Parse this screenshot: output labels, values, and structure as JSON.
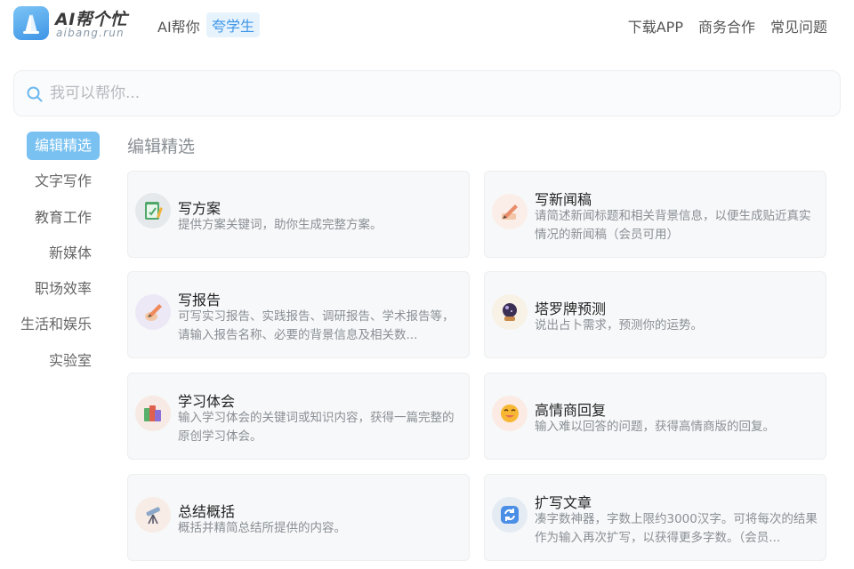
{
  "header": {
    "brand_title": "AI帮个忙",
    "brand_sub": "aibang.run",
    "slogan": "AI帮你",
    "slogan_tag": "夸学生",
    "nav": [
      "下载APP",
      "商务合作",
      "常见问题"
    ]
  },
  "search": {
    "placeholder": "我可以帮你..."
  },
  "sidebar": {
    "items": [
      "编辑精选",
      "文字写作",
      "教育工作",
      "新媒体",
      "职场效率",
      "生活和娱乐",
      "实验室"
    ],
    "active_index": 0
  },
  "main": {
    "section_title": "编辑精选",
    "cards": [
      {
        "title": "写方案",
        "desc": "提供方案关键词，助你生成完整方案。",
        "icon": "clipboard-pen-icon"
      },
      {
        "title": "写新闻稿",
        "desc": "请简述新闻标题和相关背景信息，以便生成贴近真实情况的新闻稿（会员可用）",
        "icon": "pen-writing-icon"
      },
      {
        "title": "写报告",
        "desc": "可写实习报告、实践报告、调研报告、学术报告等，请输入报告名称、必要的背景信息及相关数...",
        "icon": "pencil-hand-icon"
      },
      {
        "title": "塔罗牌预测",
        "desc": "说出占卜需求，预测你的运势。",
        "icon": "crystal-ball-icon"
      },
      {
        "title": "学习体会",
        "desc": "输入学习体会的关键词或知识内容，获得一篇完整的原创学习体会。",
        "icon": "books-icon"
      },
      {
        "title": "高情商回复",
        "desc": "输入难以回答的问题，获得高情商版的回复。",
        "icon": "smile-emoji-icon"
      },
      {
        "title": "总结概括",
        "desc": "概括并精简总结所提供的内容。",
        "icon": "telescope-icon"
      },
      {
        "title": "扩写文章",
        "desc": "凑字数神器，字数上限约3000汉字。可将每次的结果作为输入再次扩写，以获得更多字数。（会员...",
        "icon": "refresh-expand-icon"
      }
    ]
  },
  "colors": {
    "accent": "#3e95e6",
    "active_tab": "#78c1f1"
  }
}
